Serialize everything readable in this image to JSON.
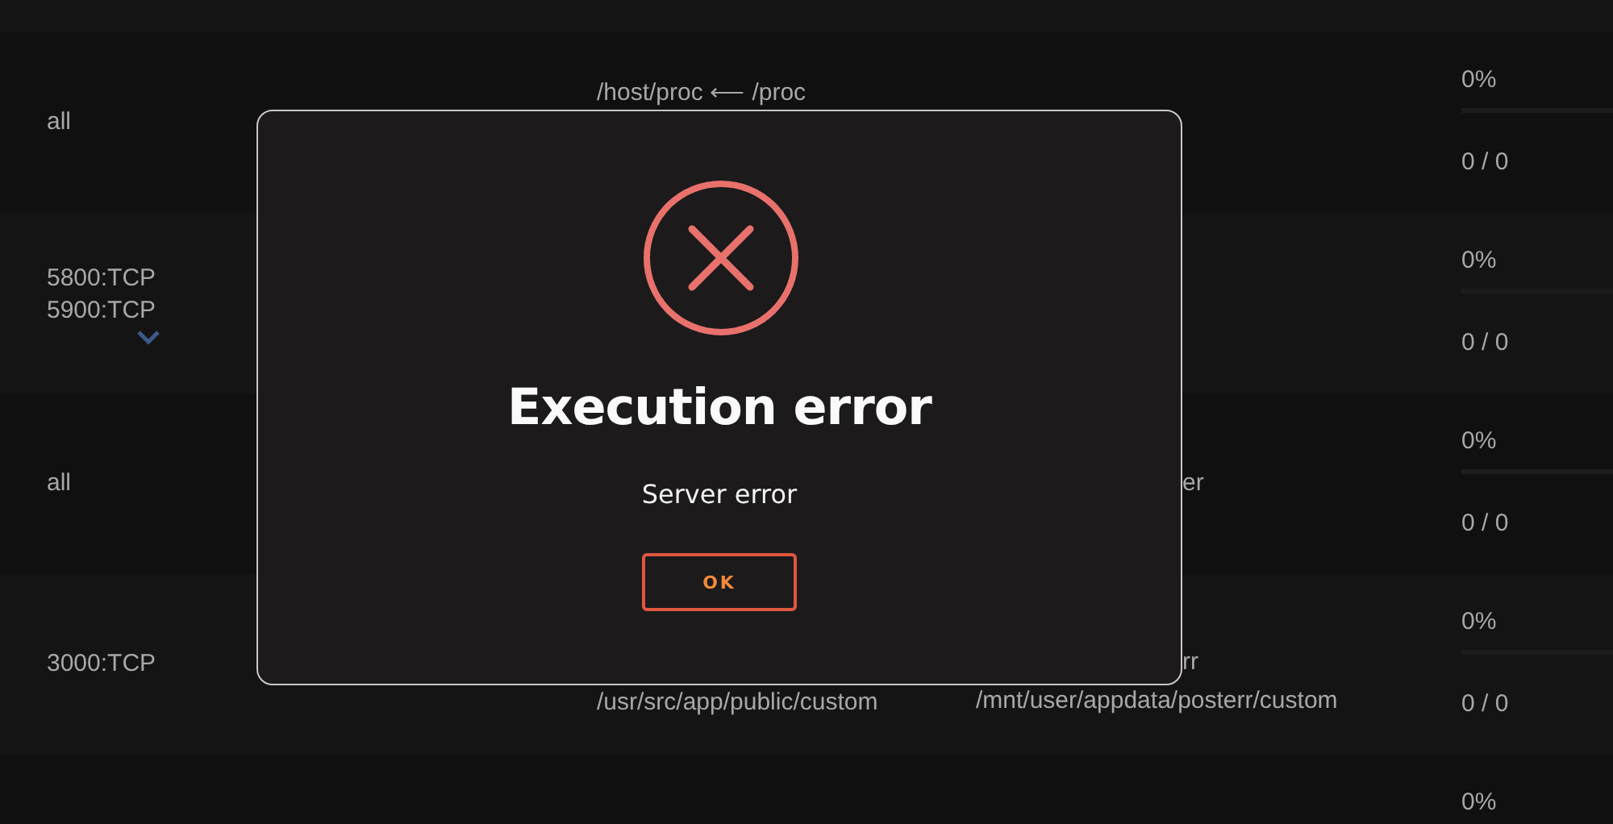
{
  "rows": [
    {
      "ports": [
        "all"
      ],
      "expandable": false,
      "container_paths": [
        "/host/proc ⟵ /proc"
      ],
      "host_paths": [],
      "cpu": "0%",
      "level": 0,
      "memory": "0 / 0"
    },
    {
      "ports": [
        "5800:TCP",
        "5900:TCP"
      ],
      "expandable": true,
      "container_paths": [],
      "host_paths": [],
      "cpu": "0%",
      "level": 0,
      "memory": "0 / 0"
    },
    {
      "ports": [
        "all"
      ],
      "expandable": false,
      "container_paths": [],
      "host_paths": [
        "er"
      ],
      "cpu": "0%",
      "level": 0,
      "memory": "0 / 0"
    },
    {
      "ports": [
        "3000:TCP"
      ],
      "expandable": false,
      "container_paths": [
        "/usr/src/app/public/custom"
      ],
      "host_paths": [
        "rr",
        "/mnt/user/appdata/posterr/custom"
      ],
      "cpu": "0%",
      "level": 0,
      "memory": "0 / 0"
    },
    {
      "ports": [],
      "expandable": false,
      "container_paths": [],
      "host_paths": [],
      "cpu": "0%"
    }
  ],
  "dialog": {
    "title": "Execution error",
    "message": "Server error",
    "button": "OK"
  }
}
